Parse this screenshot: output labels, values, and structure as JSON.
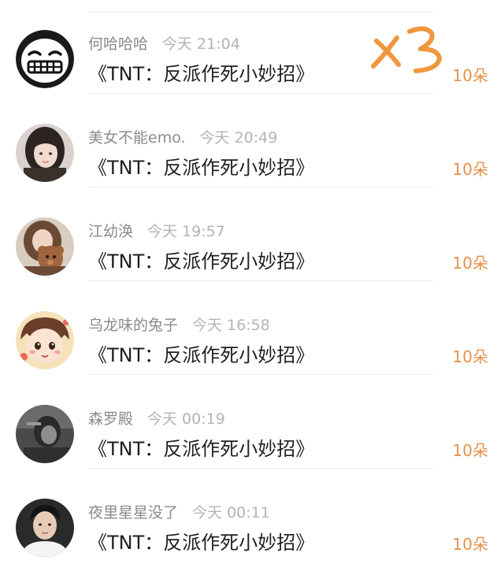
{
  "feed": {
    "items": [
      {
        "name": "何哈哈哈",
        "time": "今天 21:04",
        "message": "《TNT：反派作死小妙招》",
        "count": "10朵",
        "avatar_icon": "grinning-face-icon"
      },
      {
        "name": "美女不能emo.",
        "time": "今天 20:49",
        "message": "《TNT：反派作死小妙招》",
        "count": "10朵",
        "avatar_icon": "girl-photo-avatar"
      },
      {
        "name": "江幼涣",
        "time": "今天 19:57",
        "message": "《TNT：反派作死小妙招》",
        "count": "10朵",
        "avatar_icon": "girl-with-teddy-avatar"
      },
      {
        "name": "乌龙味的兔子",
        "time": "今天 16:58",
        "message": "《TNT：反派作死小妙招》",
        "count": "10朵",
        "avatar_icon": "cartoon-boy-avatar"
      },
      {
        "name": "森罗殿",
        "time": "今天 00:19",
        "message": "《TNT：反派作死小妙招》",
        "count": "10朵",
        "avatar_icon": "dark-photo-avatar"
      },
      {
        "name": "夜里星星没了",
        "time": "今天 00:11",
        "message": "《TNT：反派作死小妙招》",
        "count": "10朵",
        "avatar_icon": "boy-photo-avatar"
      }
    ]
  },
  "annotation": {
    "text": "x3",
    "color": "#f0963e"
  },
  "colors": {
    "count_orange": "#e6904a",
    "name_gray": "#8a8a8a",
    "time_gray": "#b4b4b4",
    "divider": "#ececec"
  }
}
